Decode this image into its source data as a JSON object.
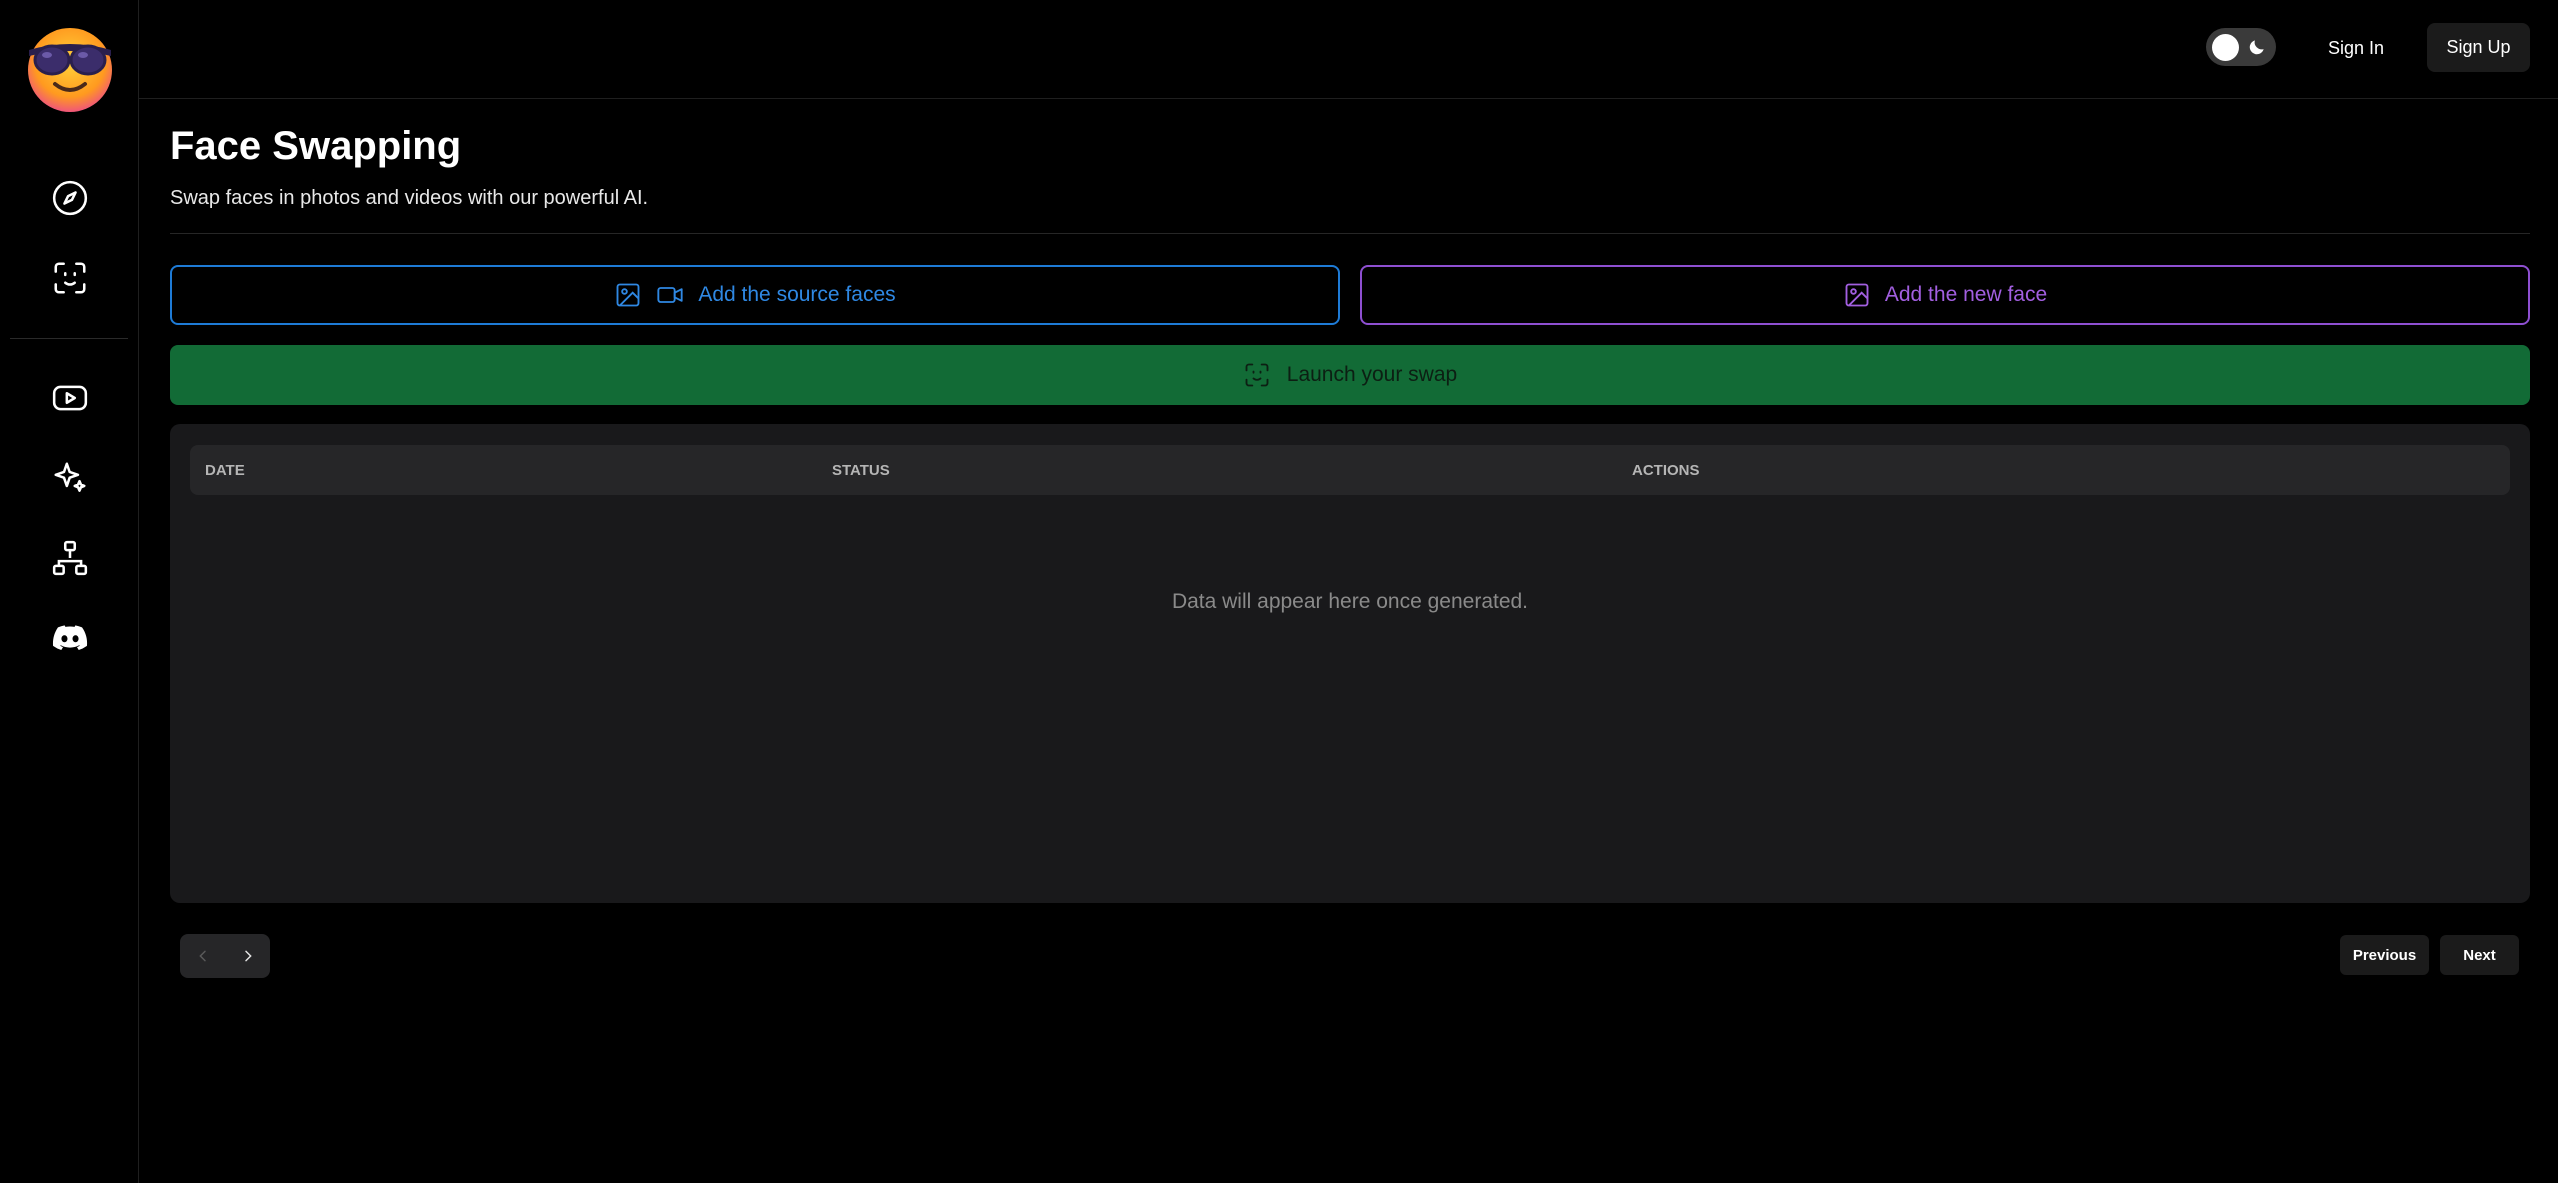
{
  "topbar": {
    "theme_toggle": "dark",
    "sign_in": "Sign In",
    "sign_up": "Sign Up"
  },
  "sidebar": {
    "items": [
      {
        "icon": "compass-icon"
      },
      {
        "icon": "face-scan-icon"
      },
      {
        "icon": "youtube-icon"
      },
      {
        "icon": "sparkles-icon"
      },
      {
        "icon": "sitemap-icon"
      },
      {
        "icon": "discord-icon"
      }
    ]
  },
  "page": {
    "title": "Face Swapping",
    "subtitle": "Swap faces in photos and videos with our powerful AI."
  },
  "actions": {
    "source_faces": "Add the source faces",
    "new_face": "Add the new face",
    "launch": "Launch your swap"
  },
  "table": {
    "columns": [
      "DATE",
      "STATUS",
      "ACTIONS"
    ],
    "empty_message": "Data will appear here once generated."
  },
  "pagination": {
    "previous": "Previous",
    "next": "Next"
  },
  "colors": {
    "source_accent": "#1e7bd6",
    "new_face_accent": "#8e4fd1",
    "launch_bg": "#126b36"
  }
}
